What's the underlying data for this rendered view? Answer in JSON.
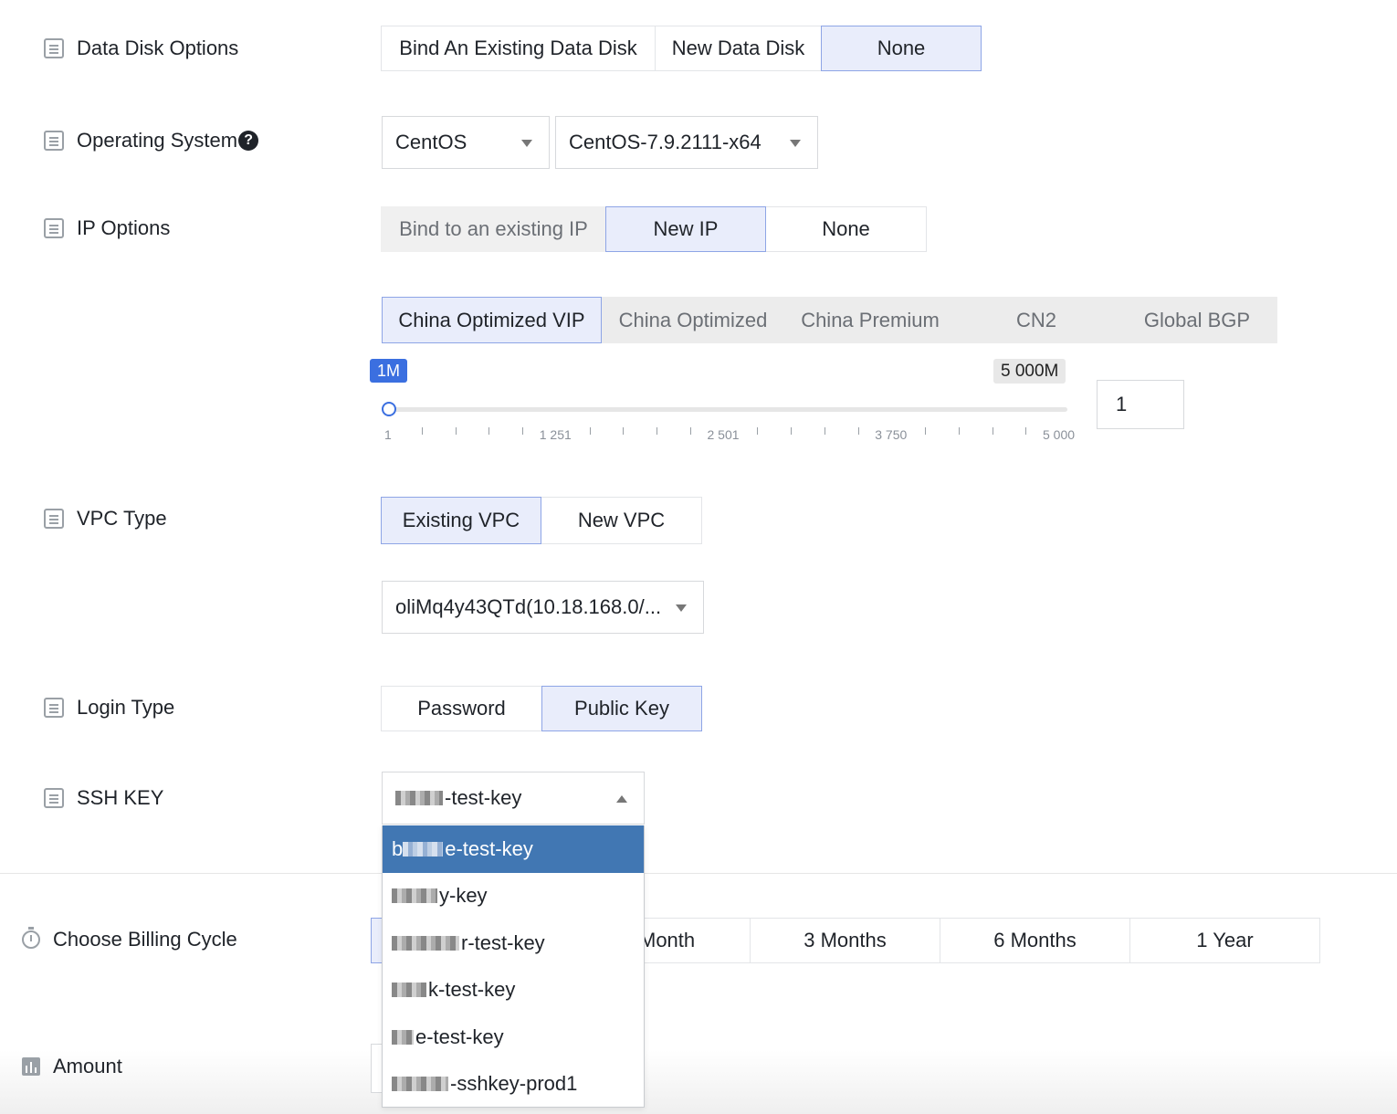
{
  "data_disk": {
    "label": "Data Disk Options",
    "options": [
      "Bind An Existing Data Disk",
      "New Data Disk",
      "None"
    ],
    "selected": "None"
  },
  "os": {
    "label": "Operating System",
    "family": "CentOS",
    "version": "CentOS-7.9.2111-x64"
  },
  "ip": {
    "label": "IP Options",
    "options": [
      "Bind to an existing IP",
      "New IP",
      "None"
    ],
    "selected": "New IP",
    "lines": [
      "China Optimized VIP",
      "China Optimized",
      "China Premium",
      "CN2",
      "Global BGP"
    ],
    "selected_line": "China Optimized VIP",
    "bandwidth": {
      "min_badge": "1M",
      "max_badge": "5 000M",
      "tick_labels": [
        "1",
        "1 251",
        "2 501",
        "3 750",
        "5 000"
      ],
      "value": "1",
      "level": 0
    }
  },
  "vpc": {
    "label": "VPC Type",
    "options": [
      "Existing VPC",
      "New VPC"
    ],
    "selected": "Existing VPC",
    "selected_vpc": "oliMq4y43QTd(10.18.168.0/..."
  },
  "login": {
    "label": "Login Type",
    "options": [
      "Password",
      "Public Key"
    ],
    "selected": "Public Key"
  },
  "ssh": {
    "label": "SSH KEY",
    "current": "-test-key",
    "dropdown": [
      "e-test-key",
      "y-key",
      "r-test-key",
      "k-test-key",
      "e-test-key",
      "-sshkey-prod1"
    ]
  },
  "billing": {
    "label": "Choose Billing Cycle",
    "options": [
      "Month",
      "3 Months",
      "6 Months",
      "1 Year"
    ]
  },
  "amount": {
    "label": "Amount"
  },
  "colors": {
    "accent": "#3b6fe0",
    "selected_bg": "#e9edfb",
    "dropdown_selected": "#4177b3"
  }
}
